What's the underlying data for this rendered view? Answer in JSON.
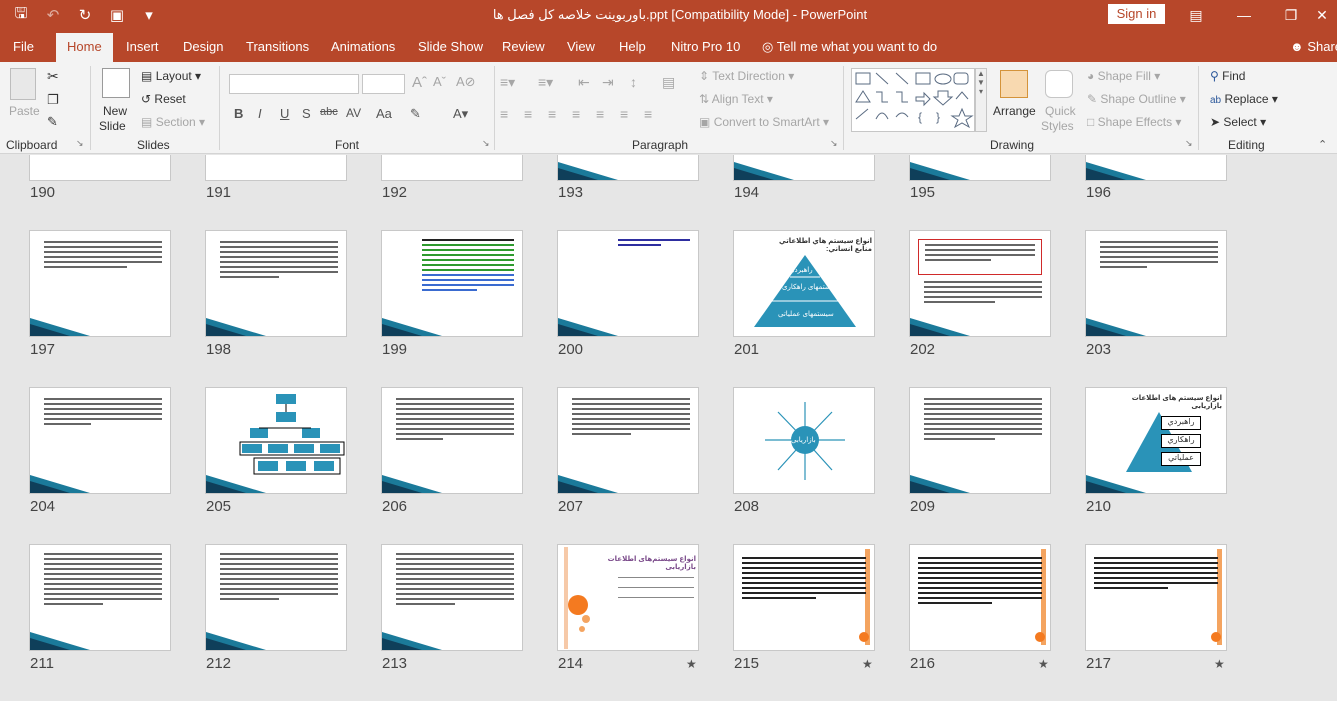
{
  "titlebar": {
    "title": "باوربوینت خلاصه کل فصل ها.ppt [Compatibility Mode]  -  PowerPoint",
    "signin": "Sign in",
    "qat": [
      "save-icon",
      "undo-icon",
      "redo-icon",
      "present-icon",
      "customize-icon"
    ]
  },
  "tabs": [
    "File",
    "Home",
    "Insert",
    "Design",
    "Transitions",
    "Animations",
    "Slide Show",
    "Review",
    "View",
    "Help",
    "Nitro Pro 10"
  ],
  "active_tab": "Home",
  "tellme": "Tell me what you want to do",
  "share": "Share",
  "ribbon": {
    "clipboard": {
      "paste": "Paste",
      "label": "Clipboard"
    },
    "slides": {
      "new_slide_1": "New",
      "new_slide_2": "Slide",
      "layout": "Layout",
      "reset": "Reset",
      "section": "Section",
      "label": "Slides"
    },
    "font": {
      "label": "Font",
      "bold": "B",
      "italic": "I",
      "underline": "U",
      "strike": "S",
      "spacing": "abc",
      "aa": "Aa"
    },
    "paragraph": {
      "text_direction": "Text Direction",
      "align_text": "Align Text",
      "smartart": "Convert to SmartArt",
      "label": "Paragraph"
    },
    "drawing": {
      "arrange": "Arrange",
      "quick_styles_1": "Quick",
      "quick_styles_2": "Styles",
      "shape_fill": "Shape Fill",
      "shape_outline": "Shape Outline",
      "shape_effects": "Shape Effects",
      "label": "Drawing"
    },
    "editing": {
      "find": "Find",
      "replace": "Replace",
      "select": "Select",
      "label": "Editing"
    }
  },
  "slides": {
    "row0": [
      "190",
      "191",
      "192",
      "193",
      "194",
      "195",
      "196"
    ],
    "row1": [
      "197",
      "198",
      "199",
      "200",
      "201",
      "202",
      "203"
    ],
    "row2": [
      "204",
      "205",
      "206",
      "207",
      "208",
      "209",
      "210"
    ],
    "row3": [
      "211",
      "212",
      "213",
      "214",
      "215",
      "216",
      "217"
    ],
    "star": "★",
    "s201_title": "انواع سيستم هاي اطلاعاتي منابع انساني:",
    "s201_levels": [
      "راهبردي",
      "سیستمهای راهکاری",
      "سیستمهای عملیاتی"
    ],
    "s208_center": "بازاریابی",
    "s210_title": "انواع سیستم های اطلاعات بازاریابی",
    "s210_levels": [
      "راهبردي",
      "راهكاري",
      "عملياتي"
    ],
    "s214_title": "انواع سیستم‌های اطلاعات بازاریابی"
  }
}
